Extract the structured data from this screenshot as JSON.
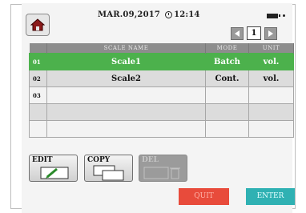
{
  "header": {
    "date": "MAR.09,2017",
    "time": "12:14",
    "home_icon": "home-icon",
    "clock_icon": "clock-icon",
    "battery_icon": "battery-icon"
  },
  "pager": {
    "page": "1",
    "prev_icon": "arrow-left-icon",
    "next_icon": "arrow-right-icon"
  },
  "table": {
    "headers": {
      "index": "",
      "name": "SCALE NAME",
      "mode": "MODE",
      "unit": "UNIT"
    },
    "rows": [
      {
        "index": "01",
        "name": "Scale1",
        "mode": "Batch",
        "unit": "vol.",
        "selected": true
      },
      {
        "index": "02",
        "name": "Scale2",
        "mode": "Cont.",
        "unit": "vol.",
        "selected": false
      },
      {
        "index": "03",
        "name": "",
        "mode": "",
        "unit": "",
        "selected": false
      },
      {
        "index": "",
        "name": "",
        "mode": "",
        "unit": "",
        "selected": false
      },
      {
        "index": "",
        "name": "",
        "mode": "",
        "unit": "",
        "selected": false
      }
    ]
  },
  "buttons": {
    "edit": "EDIT",
    "copy": "COPY",
    "delete": "DEL",
    "quit": "QUIT",
    "enter": "ENTER"
  },
  "colors": {
    "selected_row": "#4cb14c",
    "quit": "#e84b3b",
    "enter": "#2fb1b3",
    "header_bg": "#8d8d8d"
  }
}
